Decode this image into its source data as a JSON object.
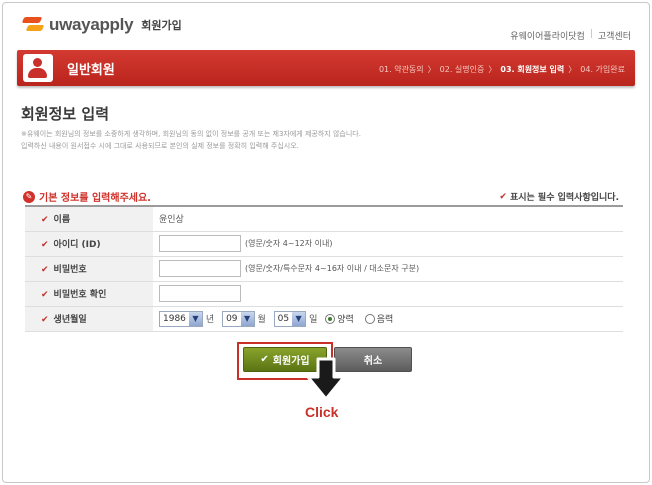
{
  "header": {
    "brand": "uwayapply",
    "subtitle": "회원가입",
    "links": [
      "유웨이어플라이닷컴",
      "고객센터"
    ]
  },
  "banner": {
    "title": "일반회원",
    "steps": [
      {
        "label": "01. 약관동의",
        "active": false
      },
      {
        "label": "02. 실명인증",
        "active": false
      },
      {
        "label": "03. 회원정보 입력",
        "active": true
      },
      {
        "label": "04. 가입완료",
        "active": false
      }
    ]
  },
  "section": {
    "title": "회원정보 입력",
    "desc1": "※유웨이는 회원님의 정보를 소중하게 생각하며, 회원님의 동의 없이 정보를 공개 또는 제3자에게 제공하지 않습니다.",
    "desc2": "입력하신 내용이 원서접수 시에 그대로 사용되므로 본인의 실제 정보를 정확히 입력해 주십시오."
  },
  "form": {
    "group_label": "기본 정보를 입력해주세요.",
    "required_note": "표시는 필수 입력사항입니다.",
    "rows": {
      "name": {
        "label": "이름",
        "value": "윤인상"
      },
      "id": {
        "label": "아이디 (ID)",
        "value": "",
        "hint": "(영문/숫자 4~12자 이내)"
      },
      "password": {
        "label": "비밀번호",
        "value": "",
        "hint": "(영문/숫자/특수문자 4~16자 이내 / 대소문자 구분)"
      },
      "password_confirm": {
        "label": "비밀번호 확인",
        "value": ""
      },
      "birth": {
        "label": "생년월일",
        "year": "1986",
        "year_unit": "년",
        "month": "09",
        "month_unit": "월",
        "day": "05",
        "day_unit": "일",
        "calendar_solar": "양력",
        "calendar_lunar": "음력",
        "selected": "양력"
      }
    }
  },
  "buttons": {
    "join": "회원가입",
    "cancel": "취소"
  },
  "annotation": {
    "click": "Click"
  },
  "colors": {
    "brand_red": "#c9302a",
    "join_green": "#6f8a1e",
    "cancel_gray": "#6e6e6e"
  }
}
